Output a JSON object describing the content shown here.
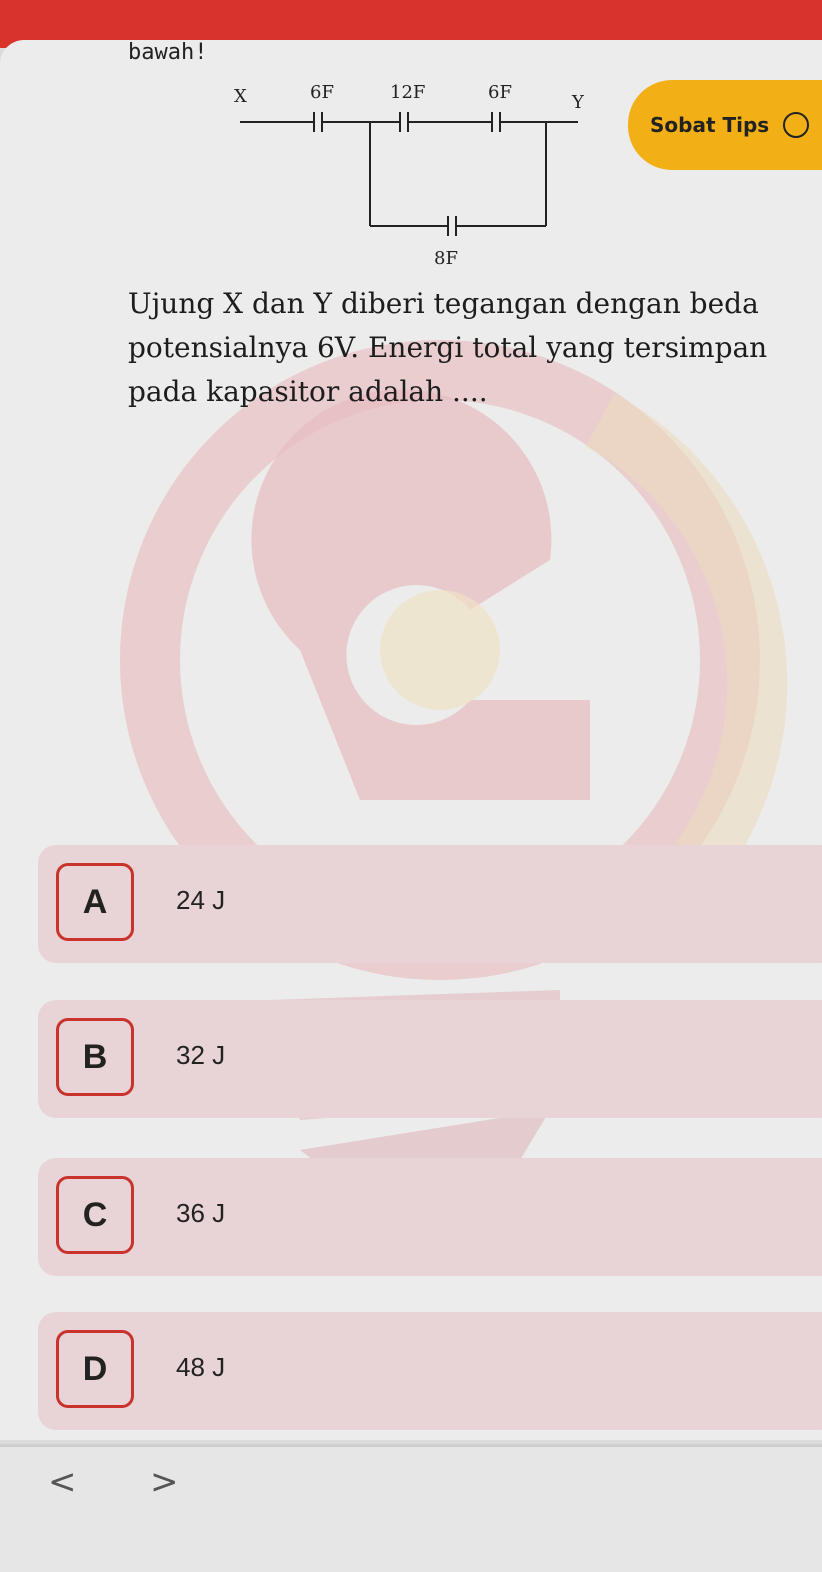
{
  "header": {
    "partial_text": "bawah!",
    "tips_label": "Sobat Tips"
  },
  "circuit": {
    "label_x": "X",
    "label_y": "Y",
    "c1": "6F",
    "c2": "12F",
    "c3": "6F",
    "c4": "8F"
  },
  "question": {
    "text": "Ujung X dan Y diberi tegangan dengan beda potensialnya 6V. Energi total yang tersimpan pada kapasitor adalah ...."
  },
  "options": [
    {
      "letter": "A",
      "value": "24 J"
    },
    {
      "letter": "B",
      "value": "32 J"
    },
    {
      "letter": "C",
      "value": "36 J"
    },
    {
      "letter": "D",
      "value": "48 J"
    }
  ],
  "nav": {
    "prev": "<",
    "next": ">"
  },
  "colors": {
    "accent_red": "#d9342b",
    "tips_yellow": "#f2b016",
    "option_bg": "#e8d3d6"
  }
}
